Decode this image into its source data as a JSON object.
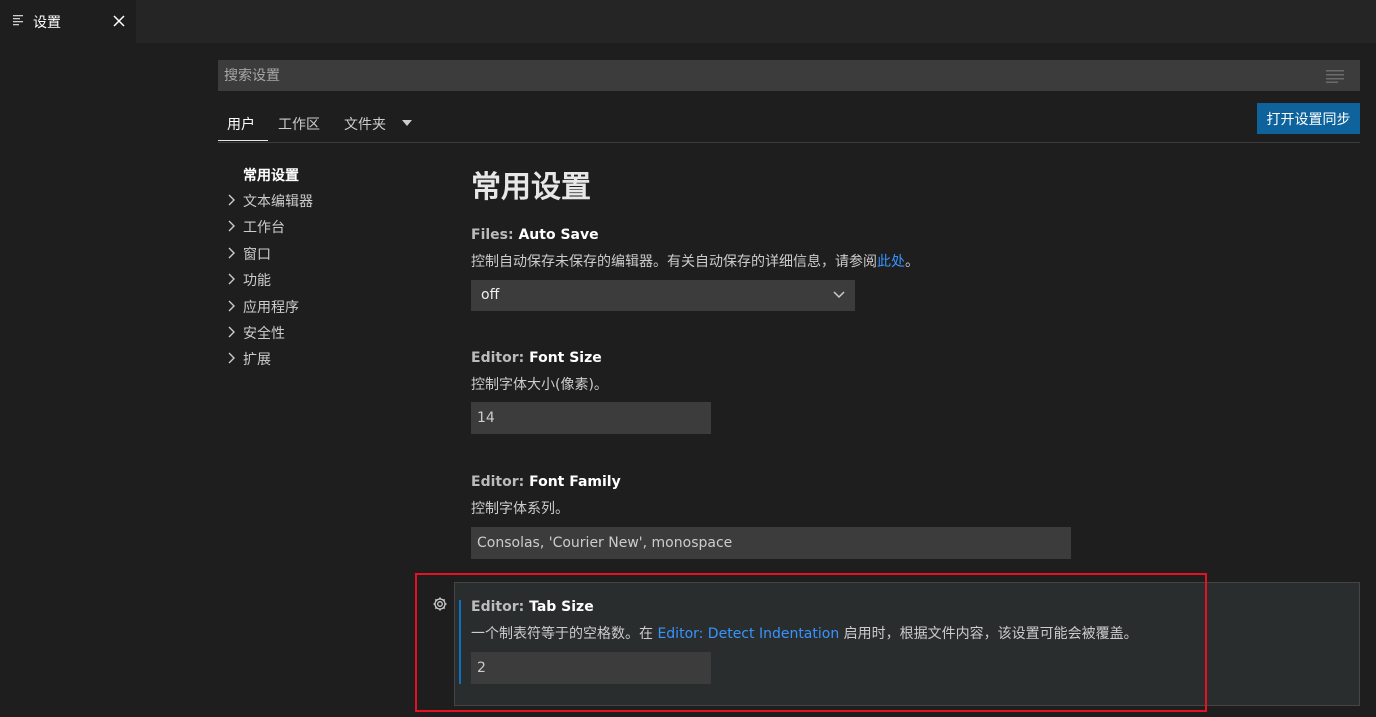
{
  "tab": {
    "title": "设置"
  },
  "search": {
    "placeholder": "搜索设置"
  },
  "scope_tabs": [
    {
      "label": "用户"
    },
    {
      "label": "工作区"
    },
    {
      "label": "文件夹"
    }
  ],
  "sync_button": "打开设置同步",
  "toc": [
    {
      "label": "常用设置"
    },
    {
      "label": "文本编辑器"
    },
    {
      "label": "工作台"
    },
    {
      "label": "窗口"
    },
    {
      "label": "功能"
    },
    {
      "label": "应用程序"
    },
    {
      "label": "安全性"
    },
    {
      "label": "扩展"
    }
  ],
  "section_title": "常用设置",
  "settings": {
    "auto_save": {
      "category": "Files: ",
      "key": "Auto Save",
      "desc": "控制自动保存未保存的编辑器。有关自动保存的详细信息，请参阅",
      "link": "此处",
      "desc_end": "。",
      "value": "off"
    },
    "font_size": {
      "category": "Editor: ",
      "key": "Font Size",
      "desc": "控制字体大小(像素)。",
      "value": "14"
    },
    "font_family": {
      "category": "Editor: ",
      "key": "Font Family",
      "desc": "控制字体系列。",
      "value": "Consolas, 'Courier New', monospace"
    },
    "tab_size": {
      "category": "Editor: ",
      "key": "Tab Size",
      "desc_start": "一个制表符等于的空格数。在 ",
      "link": "Editor: Detect Indentation",
      "desc_end": " 启用时，根据文件内容，该设置可能会被覆盖。",
      "value": "2"
    }
  },
  "colors": {
    "accent": "#0e639c",
    "link": "#3794ff",
    "highlight": "#e81123"
  },
  "icons": {
    "tab": "settings-lines-icon",
    "close": "close-icon",
    "filter": "filter-lines-icon",
    "chevron_right": "chevron-right-icon",
    "chevron_down": "chevron-down-icon",
    "gear": "gear-icon"
  }
}
